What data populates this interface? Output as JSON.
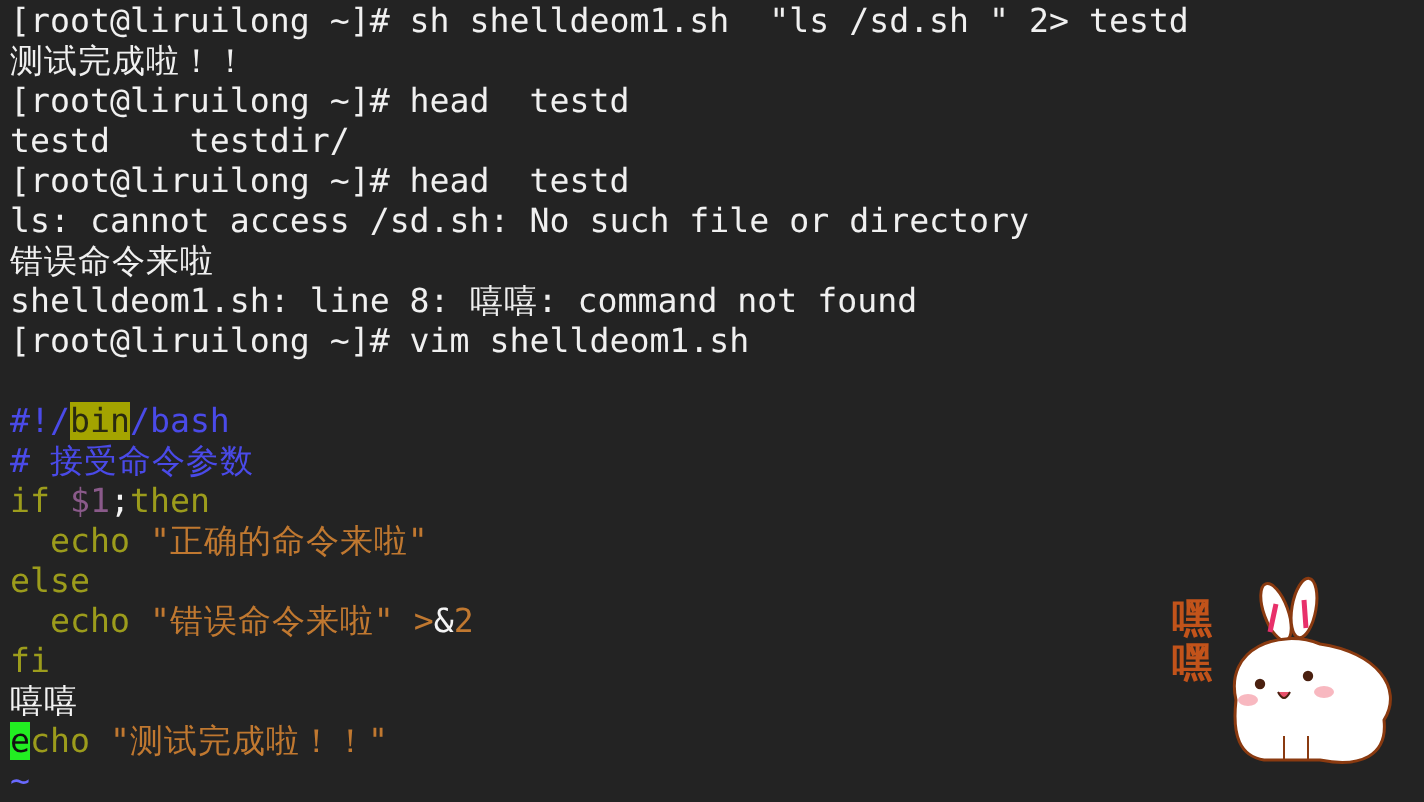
{
  "terminal_lines": [
    "[root@liruilong ~]# sh shelldeom1.sh  \"ls /sd.sh \" 2> testd",
    "测试完成啦！！",
    "[root@liruilong ~]# head  testd",
    "testd    testdir/",
    "[root@liruilong ~]# head  testd",
    "ls: cannot access /sd.sh: No such file or directory",
    "错误命令来啦",
    "shelldeom1.sh: line 8: 嘻嘻: command not found",
    "[root@liruilong ~]# vim shelldeom1.sh"
  ],
  "editor_lines": [
    [
      {
        "kind": "comment",
        "text": "#!/"
      },
      {
        "kind": "match",
        "text": "bin"
      },
      {
        "kind": "comment",
        "text": "/bash"
      }
    ],
    [
      {
        "kind": "comment",
        "text": "# 接受命令参数"
      }
    ],
    [
      {
        "kind": "keyword",
        "text": "if "
      },
      {
        "kind": "variable",
        "text": "$1"
      },
      {
        "kind": "plain",
        "text": ";"
      },
      {
        "kind": "keyword",
        "text": "then"
      }
    ],
    [
      {
        "kind": "keyword",
        "text": "  echo "
      },
      {
        "kind": "string",
        "text": "\"正确的命令来啦\""
      }
    ],
    [
      {
        "kind": "keyword",
        "text": "else"
      }
    ],
    [
      {
        "kind": "keyword",
        "text": "  echo "
      },
      {
        "kind": "string",
        "text": "\"错误命令来啦\" >"
      },
      {
        "kind": "plain",
        "text": "&"
      },
      {
        "kind": "string",
        "text": "2"
      }
    ],
    [
      {
        "kind": "keyword",
        "text": "fi"
      }
    ],
    [
      {
        "kind": "plain",
        "text": "嘻嘻"
      }
    ],
    [
      {
        "kind": "cursor",
        "text": "e"
      },
      {
        "kind": "keyword",
        "text": "cho "
      },
      {
        "kind": "string",
        "text": "\"测试完成啦！！\""
      }
    ],
    [
      {
        "kind": "tilde",
        "text": "~"
      }
    ]
  ],
  "sticker": {
    "text": "嘿嘿"
  }
}
